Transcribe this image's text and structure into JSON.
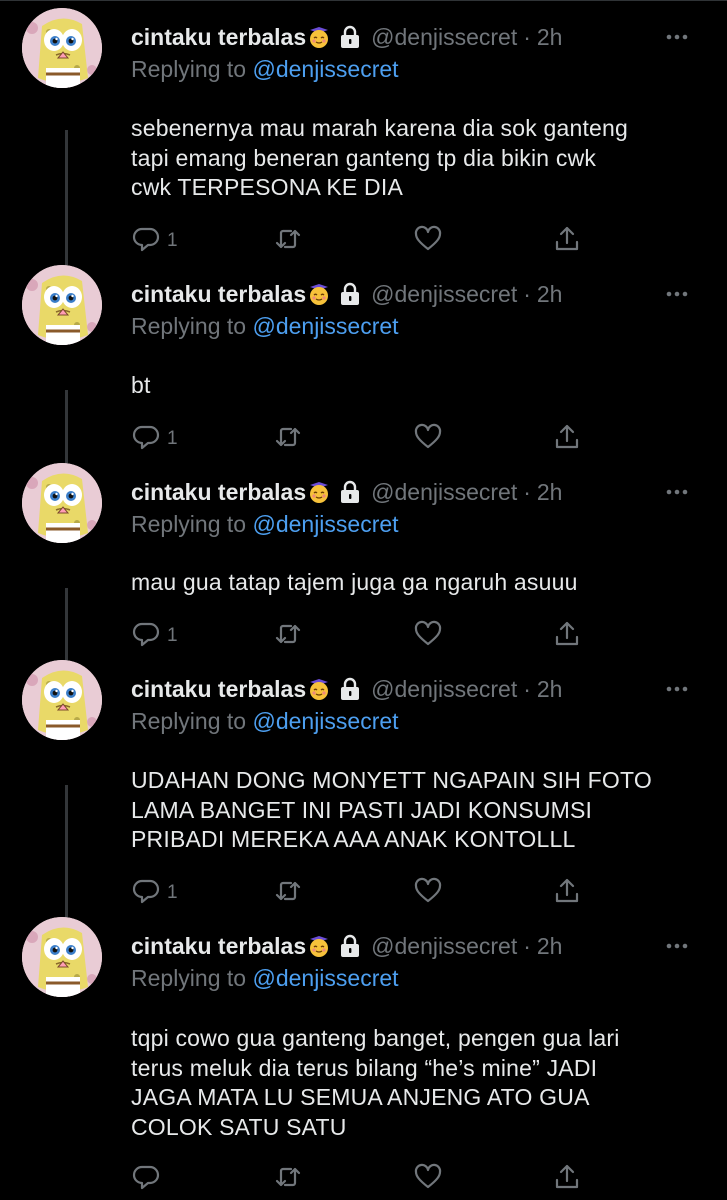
{
  "colors": {
    "background": "#000000",
    "text": "#e7e9ea",
    "secondary": "#71767b",
    "link": "#4d9ff0",
    "thread_line": "#333639"
  },
  "tweets": [
    {
      "name": "cintaku terbalas",
      "emoji_icon": "smiling-face-with-hearts-emoji",
      "lock_icon": "lock-icon",
      "handle": "@denjissecret",
      "dot": "·",
      "time": "2h",
      "replying_prefix": "Replying to",
      "replying_to": "@denjissecret",
      "lines": [
        "sebenernya mau marah karena dia sok ganteng",
        "tapi emang beneran ganteng tp dia bikin cwk",
        "cwk TERPESONA KE DIA"
      ],
      "reply_count": "1"
    },
    {
      "name": "cintaku terbalas",
      "emoji_icon": "smiling-face-with-hearts-emoji",
      "lock_icon": "lock-icon",
      "handle": "@denjissecret",
      "dot": "·",
      "time": "2h",
      "replying_prefix": "Replying to",
      "replying_to": "@denjissecret",
      "lines": [
        "bt"
      ],
      "reply_count": "1"
    },
    {
      "name": "cintaku terbalas",
      "emoji_icon": "smiling-face-with-hearts-emoji",
      "lock_icon": "lock-icon",
      "handle": "@denjissecret",
      "dot": "·",
      "time": "2h",
      "replying_prefix": "Replying to",
      "replying_to": "@denjissecret",
      "lines": [
        "mau gua tatap tajem juga ga ngaruh asuuu"
      ],
      "reply_count": "1"
    },
    {
      "name": "cintaku terbalas",
      "emoji_icon": "smiling-face-with-hearts-emoji",
      "lock_icon": "lock-icon",
      "handle": "@denjissecret",
      "dot": "·",
      "time": "2h",
      "replying_prefix": "Replying to",
      "replying_to": "@denjissecret",
      "lines": [
        "UDAHAN DONG MONYETT NGAPAIN SIH FOTO",
        "LAMA BANGET INI PASTI JADI KONSUMSI",
        "PRIBADI MEREKA AAA ANAK KONTOLLL"
      ],
      "reply_count": "1"
    },
    {
      "name": "cintaku terbalas",
      "emoji_icon": "smiling-face-with-hearts-emoji",
      "lock_icon": "lock-icon",
      "handle": "@denjissecret",
      "dot": "·",
      "time": "2h",
      "replying_prefix": "Replying to",
      "replying_to": "@denjissecret",
      "lines": [
        "tqpi cowo gua ganteng banget, pengen gua lari",
        "terus meluk dia terus bilang “he’s mine” JADI",
        "JAGA MATA LU SEMUA ANJENG ATO GUA",
        "COLOK SATU SATU"
      ],
      "reply_count": ""
    }
  ]
}
